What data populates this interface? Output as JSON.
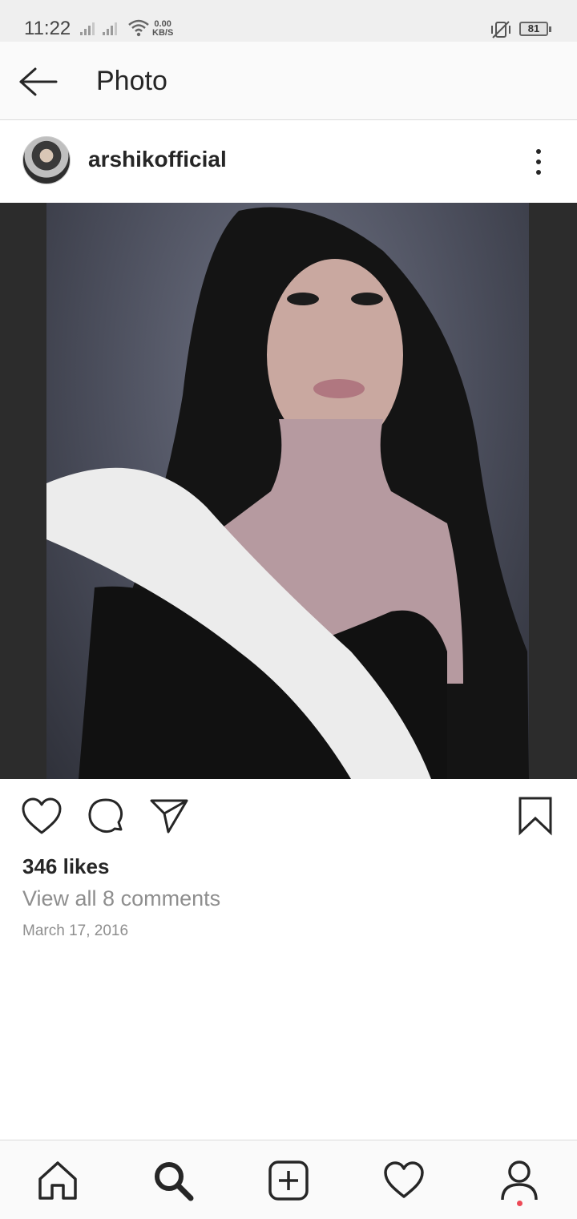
{
  "status_bar": {
    "time": "11:22",
    "net_speed_value": "0.00",
    "net_speed_unit": "KB/S",
    "battery": "81"
  },
  "header": {
    "title": "Photo",
    "back_icon": "arrow-left-icon"
  },
  "post": {
    "username": "arshikofficial",
    "avatar_icon": "profile-avatar",
    "more_icon": "more-vertical-icon",
    "likes": "346 likes",
    "comments_link": "View all 8 comments",
    "date": "March 17, 2016"
  },
  "actions": {
    "like_icon": "heart-outline-icon",
    "comment_icon": "comment-bubble-icon",
    "share_icon": "paper-plane-icon",
    "save_icon": "bookmark-outline-icon"
  },
  "bottom_nav": {
    "items": [
      "home-icon",
      "search-icon",
      "add-post-icon",
      "activity-heart-icon",
      "profile-icon"
    ],
    "active": "search-icon",
    "notification_dot_color": "#ed4956"
  },
  "colors": {
    "text_primary": "#262626",
    "text_secondary": "#8e8e8e",
    "divider": "#dbdbdb"
  }
}
